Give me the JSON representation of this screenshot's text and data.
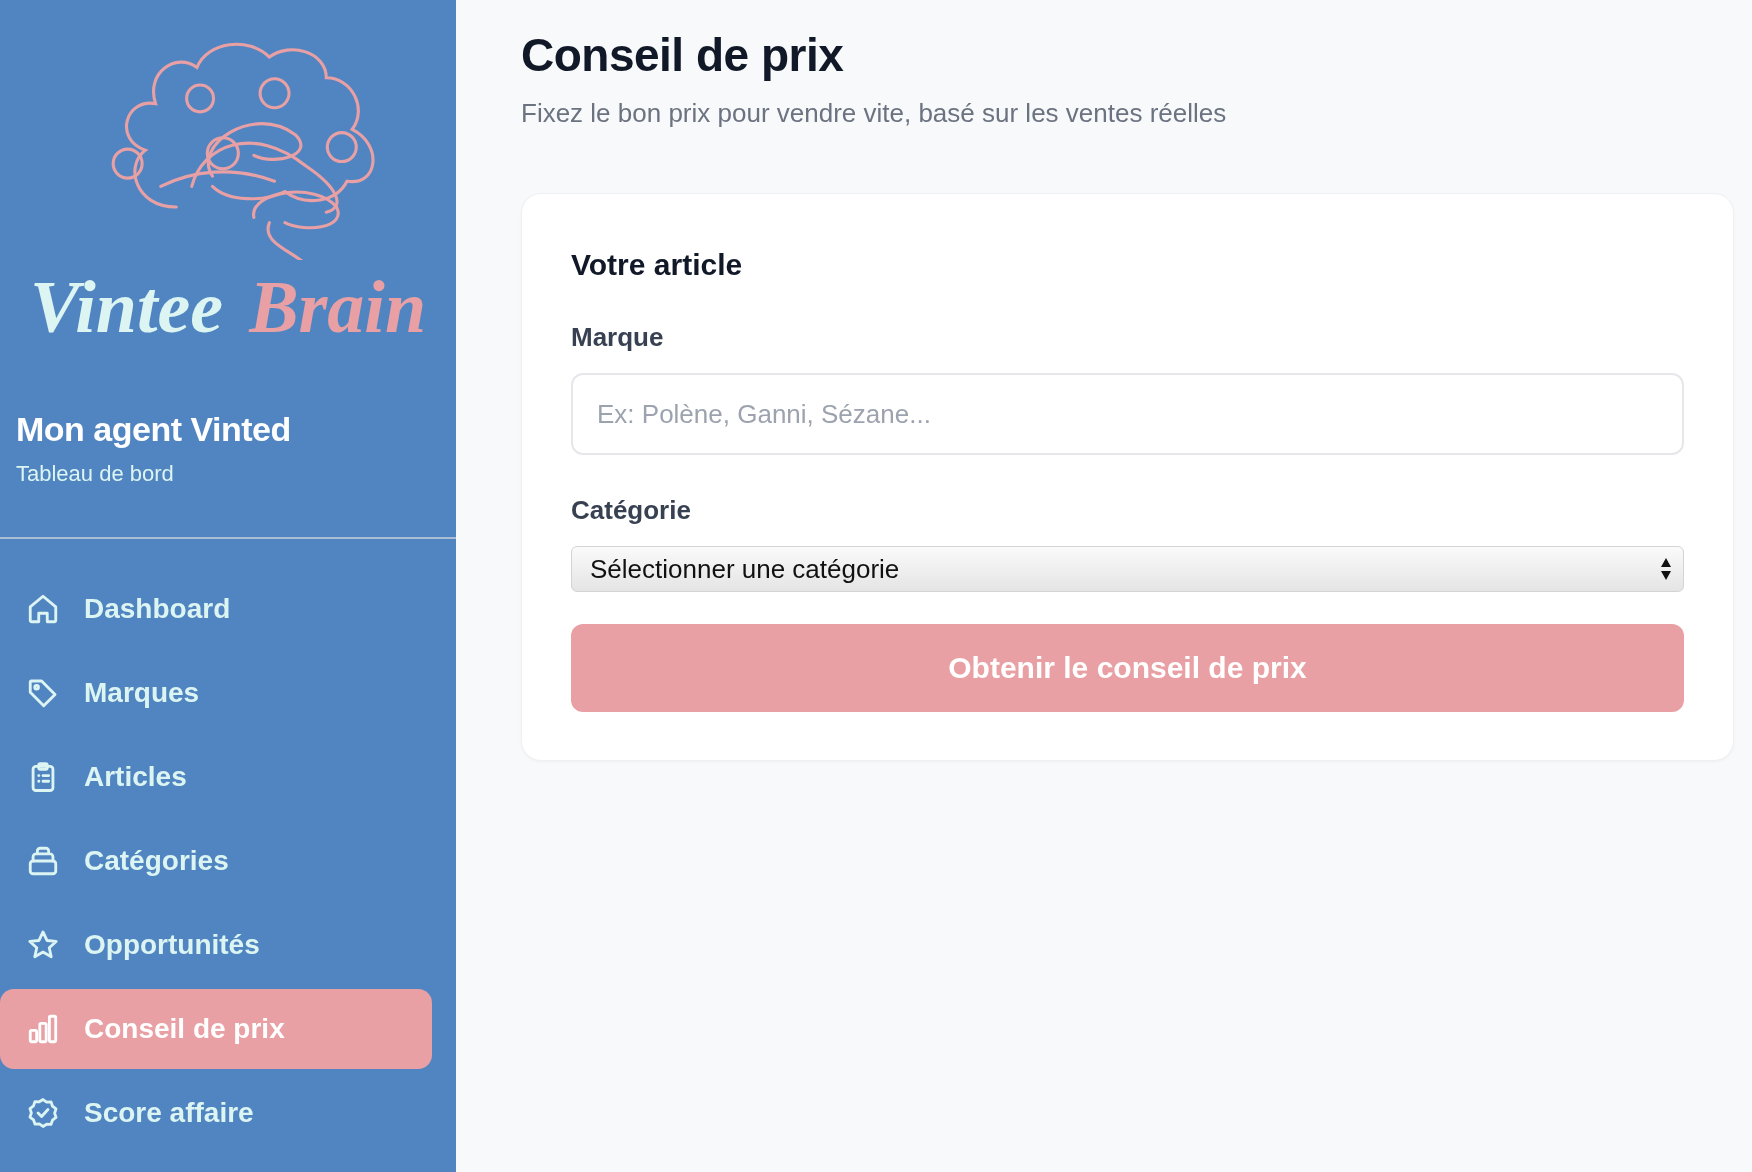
{
  "sidebar": {
    "logo": {
      "word_1": "Vintee",
      "word_2": "Brain"
    },
    "title": "Mon agent Vinted",
    "subtitle": "Tableau de bord",
    "items": [
      {
        "label": "Dashboard",
        "selected": false
      },
      {
        "label": "Marques",
        "selected": false
      },
      {
        "label": "Articles",
        "selected": false
      },
      {
        "label": "Catégories",
        "selected": false
      },
      {
        "label": "Opportunités",
        "selected": false
      },
      {
        "label": "Conseil de prix",
        "selected": true
      },
      {
        "label": "Score affaire",
        "selected": false
      }
    ]
  },
  "page": {
    "title": "Conseil de prix",
    "subtitle": "Fixez le bon prix pour vendre vite, basé sur les ventes réelles"
  },
  "form": {
    "title": "Votre article",
    "brand": {
      "label": "Marque",
      "placeholder": "Ex: Polène, Ganni, Sézane..."
    },
    "category": {
      "label": "Catégorie",
      "value": "Sélectionner une catégorie"
    },
    "submit": "Obtenir le conseil de prix"
  }
}
